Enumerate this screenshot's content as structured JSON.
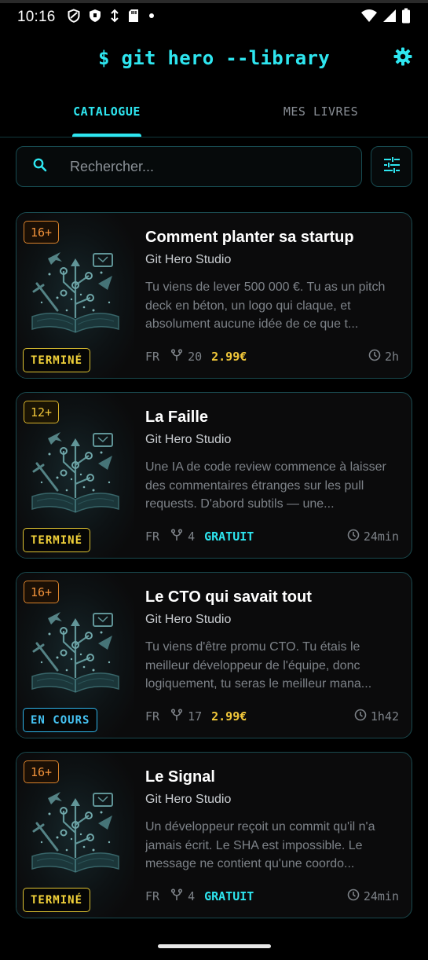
{
  "status_bar": {
    "time": "10:16",
    "icons": [
      "vpn-shield-icon",
      "shield-icon",
      "data-saver-icon",
      "sd-card-icon",
      "dot-icon",
      "wifi-icon",
      "signal-icon",
      "battery-icon"
    ]
  },
  "header": {
    "title": "$ git hero --library",
    "settings_icon": "gear-icon"
  },
  "colors": {
    "accent": "#2ee6f0",
    "price_paid": "#f2c83a",
    "badge_done": "#f2d23a",
    "badge_in_progress": "#46c4f4",
    "age_16": "#f0913a",
    "age_12": "#f2c83a"
  },
  "tabs": [
    {
      "label": "CATALOGUE",
      "active": true
    },
    {
      "label": "MES LIVRES",
      "active": false
    }
  ],
  "search": {
    "placeholder": "Rechercher...",
    "icon": "search-icon",
    "filter_icon": "sliders-icon"
  },
  "books": [
    {
      "age": "16+",
      "status": "TERMINÉ",
      "title": "Comment planter sa startup",
      "author": "Git Hero Studio",
      "description": "Tu viens de lever 500 000 €. Tu as un pitch deck en béton, un logo qui claque, et absolument aucune idée de ce que t...",
      "lang": "FR",
      "forks": "20",
      "price": "2.99€",
      "duration": "2h"
    },
    {
      "age": "12+",
      "status": "TERMINÉ",
      "title": "La Faille",
      "author": "Git Hero Studio",
      "description": "Une IA de code review commence à laisser des commentaires étranges sur les pull requests. D'abord subtils — une...",
      "lang": "FR",
      "forks": "4",
      "price": "GRATUIT",
      "duration": "24min"
    },
    {
      "age": "16+",
      "status": "EN COURS",
      "title": "Le CTO qui savait tout",
      "author": "Git Hero Studio",
      "description": "Tu viens d'être promu CTO. Tu étais le meilleur développeur de l'équipe, donc logiquement, tu seras le meilleur mana...",
      "lang": "FR",
      "forks": "17",
      "price": "2.99€",
      "duration": "1h42"
    },
    {
      "age": "16+",
      "status": "TERMINÉ",
      "title": "Le Signal",
      "author": "Git Hero Studio",
      "description": "Un développeur reçoit un commit qu'il n'a jamais écrit. Le SHA est impossible. Le message ne contient qu'une coordo...",
      "lang": "FR",
      "forks": "4",
      "price": "GRATUIT",
      "duration": "24min"
    }
  ]
}
